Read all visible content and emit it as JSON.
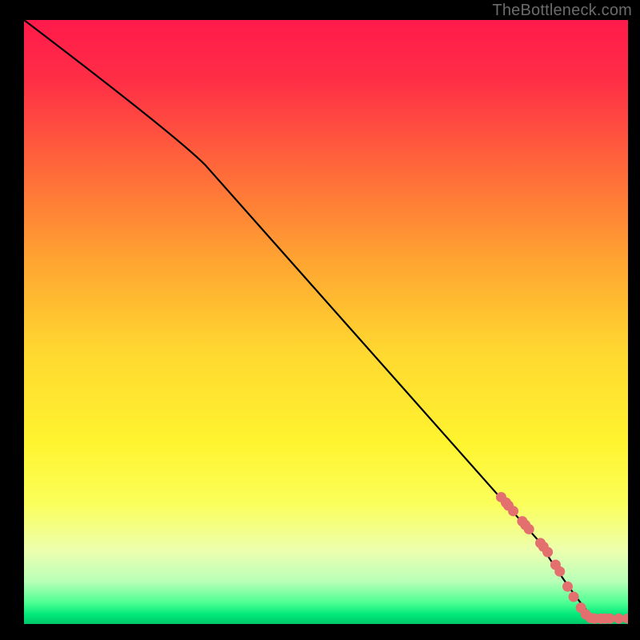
{
  "watermark": "TheBottleneck.com",
  "chart_data": {
    "type": "line",
    "title": "",
    "xlabel": "",
    "ylabel": "",
    "xlim": [
      0,
      100
    ],
    "ylim": [
      0,
      100
    ],
    "gradient_stops": [
      {
        "offset": 0,
        "color": "#ff1a4b"
      },
      {
        "offset": 0.1,
        "color": "#ff2e46"
      },
      {
        "offset": 0.25,
        "color": "#ff6a3a"
      },
      {
        "offset": 0.4,
        "color": "#ffa531"
      },
      {
        "offset": 0.55,
        "color": "#ffd830"
      },
      {
        "offset": 0.7,
        "color": "#fff42f"
      },
      {
        "offset": 0.8,
        "color": "#fbff5a"
      },
      {
        "offset": 0.88,
        "color": "#ecffb0"
      },
      {
        "offset": 0.93,
        "color": "#b7ffb7"
      },
      {
        "offset": 0.965,
        "color": "#4dff93"
      },
      {
        "offset": 0.985,
        "color": "#00e879"
      },
      {
        "offset": 1.0,
        "color": "#00c76a"
      }
    ],
    "curve": [
      {
        "x": 0,
        "y": 100
      },
      {
        "x": 25,
        "y": 81
      },
      {
        "x": 30,
        "y": 76
      },
      {
        "x": 85,
        "y": 14
      },
      {
        "x": 90,
        "y": 6
      },
      {
        "x": 94,
        "y": 1.2
      },
      {
        "x": 100,
        "y": 0.8
      }
    ],
    "scatter": [
      {
        "x": 79.0,
        "y": 21.0
      },
      {
        "x": 79.8,
        "y": 20.1
      },
      {
        "x": 80.2,
        "y": 19.6
      },
      {
        "x": 81.0,
        "y": 18.7
      },
      {
        "x": 82.5,
        "y": 17.0
      },
      {
        "x": 83.0,
        "y": 16.4
      },
      {
        "x": 83.6,
        "y": 15.7
      },
      {
        "x": 85.5,
        "y": 13.4
      },
      {
        "x": 86.0,
        "y": 12.8
      },
      {
        "x": 86.7,
        "y": 11.9
      },
      {
        "x": 88.0,
        "y": 9.8
      },
      {
        "x": 88.7,
        "y": 8.7
      },
      {
        "x": 90.0,
        "y": 6.2
      },
      {
        "x": 91.0,
        "y": 4.5
      },
      {
        "x": 92.2,
        "y": 2.7
      },
      {
        "x": 93.0,
        "y": 1.6
      },
      {
        "x": 93.8,
        "y": 1.0
      },
      {
        "x": 94.5,
        "y": 0.9
      },
      {
        "x": 95.5,
        "y": 0.9
      },
      {
        "x": 96.2,
        "y": 0.9
      },
      {
        "x": 97.0,
        "y": 0.9
      },
      {
        "x": 98.5,
        "y": 0.9
      },
      {
        "x": 100.0,
        "y": 0.9
      }
    ],
    "scatter_color": "#e36f6f",
    "scatter_radius": 6.5
  }
}
